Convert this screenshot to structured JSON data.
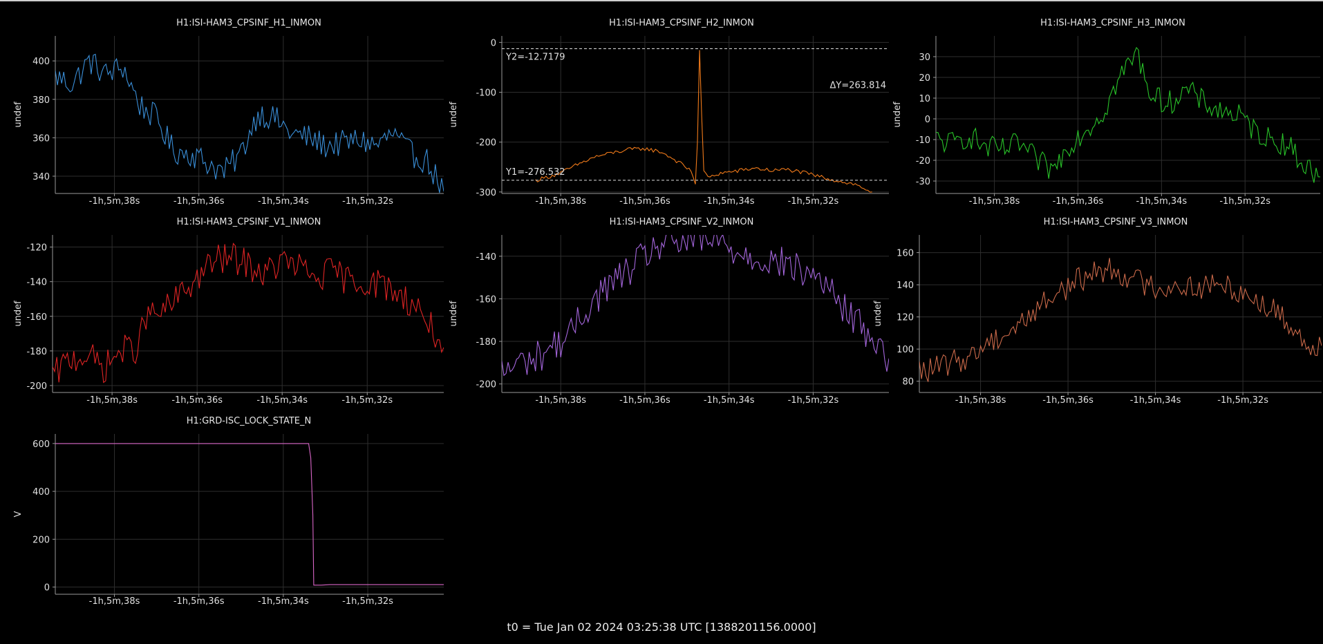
{
  "footer": "t0 = Tue Jan 02 2024 03:25:38 UTC [1388201156.0000]",
  "colors": {
    "background": "#000000",
    "grid": "#2e2e2e",
    "axis": "#9a9a9a"
  },
  "chart_data": [
    {
      "type": "line",
      "title": "H1:ISI-HAM3_CPSINF_H1_INMON",
      "ylabel": "undef",
      "xlim": [
        -99.4,
        -90.2
      ],
      "ylim": [
        331,
        413
      ],
      "yticks": [
        340,
        360,
        380,
        400
      ],
      "xticks": [
        -98,
        -96,
        -94,
        -92
      ],
      "xticklabels": [
        "-1h,5m,38s",
        "-1h,5m,36s",
        "-1h,5m,34s",
        "-1h,5m,32s"
      ],
      "color": "#3a8fd9",
      "series": [
        {
          "x": [
            -99.4,
            -99.0,
            -98.6,
            -98.2,
            -97.8,
            -97.4,
            -97.0,
            -96.6,
            -96.2,
            -95.8,
            -95.4,
            -95.0,
            -94.6,
            -94.2,
            -93.8,
            -93.4,
            -93.0,
            -92.6,
            -92.2,
            -91.8,
            -91.4,
            -91.0,
            -90.6,
            -90.2
          ],
          "y": [
            392,
            388,
            400,
            393,
            397,
            377,
            370,
            353,
            352,
            347,
            342,
            352,
            373,
            370,
            362,
            360,
            356,
            357,
            359,
            356,
            362,
            352,
            348,
            332
          ],
          "noise": 7
        }
      ]
    },
    {
      "type": "line",
      "title": "H1:ISI-HAM3_CPSINF_H2_INMON",
      "ylabel": "undef",
      "xlim": [
        -99.4,
        -90.2
      ],
      "ylim": [
        -303,
        13
      ],
      "yticks": [
        0,
        -100,
        -200,
        -300
      ],
      "xticks": [
        -98,
        -96,
        -94,
        -92
      ],
      "xticklabels": [
        "-1h,5m,38s",
        "-1h,5m,36s",
        "-1h,5m,34s",
        "-1h,5m,32s"
      ],
      "color": "#f07a1a",
      "cursors": [
        {
          "label": "Y2=-12.7179",
          "value": -12.7179
        },
        {
          "label": "Y1=-276.532",
          "value": -276.532
        }
      ],
      "delta_label": "ΔY=263.814",
      "series": [
        {
          "x": [
            -98.6,
            -98.0,
            -97.6,
            -97.2,
            -96.8,
            -96.4,
            -96.0,
            -95.6,
            -95.2,
            -94.9,
            -94.8,
            -94.75,
            -94.7,
            -94.65,
            -94.6,
            -94.5,
            -94.2,
            -93.8,
            -93.4,
            -93.0,
            -92.6,
            -92.2,
            -91.8,
            -91.4,
            -91.0,
            -90.6
          ],
          "y": [
            -277,
            -262,
            -245,
            -230,
            -222,
            -215,
            -213,
            -220,
            -240,
            -258,
            -282,
            -200,
            -15,
            -150,
            -255,
            -272,
            -262,
            -258,
            -252,
            -257,
            -255,
            -262,
            -270,
            -278,
            -285,
            -300
          ],
          "noise": 4
        }
      ]
    },
    {
      "type": "line",
      "title": "H1:ISI-HAM3_CPSINF_H3_INMON",
      "ylabel": "undef",
      "xlim": [
        -99.4,
        -90.2
      ],
      "ylim": [
        -36,
        40
      ],
      "yticks": [
        30,
        20,
        10,
        0,
        -10,
        -20,
        -30
      ],
      "xticks": [
        -98,
        -96,
        -94,
        -92
      ],
      "xticklabels": [
        "-1h,5m,38s",
        "-1h,5m,36s",
        "-1h,5m,34s",
        "-1h,5m,32s"
      ],
      "color": "#29c429",
      "series": [
        {
          "x": [
            -99.4,
            -99.0,
            -98.6,
            -98.2,
            -97.8,
            -97.4,
            -97.0,
            -96.6,
            -96.2,
            -95.8,
            -95.4,
            -95.0,
            -94.6,
            -94.2,
            -93.8,
            -93.4,
            -93.0,
            -92.6,
            -92.2,
            -91.8,
            -91.4,
            -91.0,
            -90.6,
            -90.2
          ],
          "y": [
            -10,
            -12,
            -8,
            -14,
            -15,
            -12,
            -20,
            -25,
            -12,
            -5,
            3,
            20,
            32,
            10,
            8,
            14,
            8,
            4,
            2,
            -5,
            -10,
            -12,
            -22,
            -28
          ],
          "noise": 6
        }
      ]
    },
    {
      "type": "line",
      "title": "H1:ISI-HAM3_CPSINF_V1_INMON",
      "ylabel": "undef",
      "xlim": [
        -99.4,
        -90.2
      ],
      "ylim": [
        -204,
        -113
      ],
      "yticks": [
        -120,
        -140,
        -160,
        -180,
        -200
      ],
      "xticks": [
        -98,
        -96,
        -94,
        -92
      ],
      "xticklabels": [
        "-1h,5m,38s",
        "-1h,5m,36s",
        "-1h,5m,34s",
        "-1h,5m,32s"
      ],
      "color": "#e02424",
      "series": [
        {
          "x": [
            -99.4,
            -99.0,
            -98.6,
            -98.2,
            -97.8,
            -97.4,
            -97.2,
            -96.8,
            -96.4,
            -96.0,
            -95.6,
            -95.2,
            -94.8,
            -94.4,
            -94.0,
            -93.6,
            -93.2,
            -92.8,
            -92.4,
            -92.0,
            -91.6,
            -91.2,
            -90.8,
            -90.4,
            -90.2
          ],
          "y": [
            -195,
            -185,
            -182,
            -190,
            -180,
            -178,
            -160,
            -158,
            -148,
            -138,
            -128,
            -126,
            -130,
            -136,
            -128,
            -132,
            -138,
            -134,
            -140,
            -140,
            -142,
            -148,
            -155,
            -170,
            -178
          ],
          "noise": 9
        }
      ]
    },
    {
      "type": "line",
      "title": "H1:ISI-HAM3_CPSINF_V2_INMON",
      "ylabel": "undef",
      "xlim": [
        -99.4,
        -90.2
      ],
      "ylim": [
        -204,
        -130
      ],
      "yticks": [
        -140,
        -160,
        -180,
        -200
      ],
      "xticks": [
        -98,
        -96,
        -94,
        -92
      ],
      "xticklabels": [
        "-1h,5m,38s",
        "-1h,5m,36s",
        "-1h,5m,34s",
        "-1h,5m,32s"
      ],
      "color": "#a566dd",
      "series": [
        {
          "x": [
            -99.4,
            -99.0,
            -98.6,
            -98.2,
            -97.8,
            -97.4,
            -97.0,
            -96.6,
            -96.2,
            -95.8,
            -95.4,
            -95.0,
            -94.6,
            -94.2,
            -93.8,
            -93.4,
            -93.0,
            -92.6,
            -92.2,
            -91.8,
            -91.4,
            -91.0,
            -90.6,
            -90.2
          ],
          "y": [
            -195,
            -190,
            -188,
            -182,
            -178,
            -165,
            -156,
            -150,
            -144,
            -136,
            -134,
            -133,
            -133,
            -134,
            -138,
            -140,
            -142,
            -144,
            -148,
            -150,
            -162,
            -170,
            -178,
            -188
          ],
          "noise": 8
        }
      ]
    },
    {
      "type": "line",
      "title": "H1:ISI-HAM3_CPSINF_V3_INMON",
      "ylabel": "undef",
      "xlim": [
        -99.4,
        -90.2
      ],
      "ylim": [
        73,
        171
      ],
      "yticks": [
        160,
        140,
        120,
        100,
        80
      ],
      "xticks": [
        -98,
        -96,
        -94,
        -92
      ],
      "xticklabels": [
        "-1h,5m,38s",
        "-1h,5m,36s",
        "-1h,5m,34s",
        "-1h,5m,32s"
      ],
      "color": "#cc6a4a",
      "series": [
        {
          "x": [
            -99.4,
            -99.0,
            -98.6,
            -98.2,
            -97.8,
            -97.4,
            -97.0,
            -96.6,
            -96.2,
            -95.8,
            -95.4,
            -95.0,
            -94.6,
            -94.2,
            -93.8,
            -93.4,
            -93.0,
            -92.6,
            -92.2,
            -91.8,
            -91.4,
            -91.0,
            -90.6,
            -90.2
          ],
          "y": [
            86,
            88,
            92,
            96,
            105,
            110,
            118,
            128,
            136,
            142,
            148,
            150,
            145,
            140,
            138,
            140,
            138,
            140,
            138,
            132,
            126,
            118,
            104,
            102
          ],
          "noise": 8
        }
      ]
    },
    {
      "type": "line",
      "title": "H1:GRD-ISC_LOCK_STATE_N",
      "ylabel": "V",
      "xlim": [
        -99.4,
        -90.2
      ],
      "ylim": [
        -30,
        640
      ],
      "yticks": [
        600,
        400,
        200,
        0
      ],
      "xticks": [
        -98,
        -96,
        -94,
        -92
      ],
      "xticklabels": [
        "-1h,5m,38s",
        "-1h,5m,36s",
        "-1h,5m,34s",
        "-1h,5m,32s"
      ],
      "color": "#d966c8",
      "series": [
        {
          "x": [
            -99.4,
            -93.4,
            -93.35,
            -93.3,
            -93.28,
            -93.1,
            -92.9,
            -90.2
          ],
          "y": [
            600,
            600,
            540,
            300,
            8,
            8,
            10,
            10
          ],
          "noise": 0
        }
      ]
    }
  ]
}
